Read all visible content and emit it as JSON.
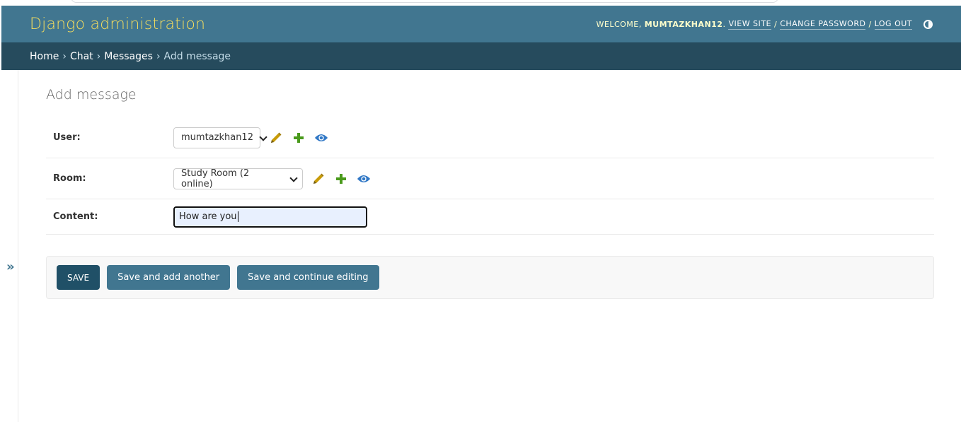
{
  "header": {
    "brand": "Django administration",
    "welcome_text": "Welcome,",
    "username": "mumtazkhan12",
    "username_suffix": ".",
    "view_site": "View site",
    "change_password": "Change password",
    "log_out": "Log out",
    "separator": "/"
  },
  "breadcrumbs": {
    "home": "Home",
    "app": "Chat",
    "model": "Messages",
    "current": "Add message",
    "separator": "›"
  },
  "sidebar": {
    "toggle_glyph": "»"
  },
  "page": {
    "title": "Add message"
  },
  "form": {
    "user": {
      "label": "User:",
      "selected": "mumtazkhan12"
    },
    "room": {
      "label": "Room:",
      "selected": "Study Room (2 online)"
    },
    "content": {
      "label": "Content:",
      "value": "How are you"
    }
  },
  "buttons": {
    "save": "Save",
    "save_add_another": "Save and add another",
    "save_continue": "Save and continue editing"
  },
  "colors": {
    "header_bg": "#417690",
    "breadcrumbs_bg": "#264b5d",
    "brand_yellow": "#f5dd5d",
    "edit_icon": "#c89b08",
    "add_icon": "#4a9a1c",
    "view_icon": "#3178c6"
  }
}
